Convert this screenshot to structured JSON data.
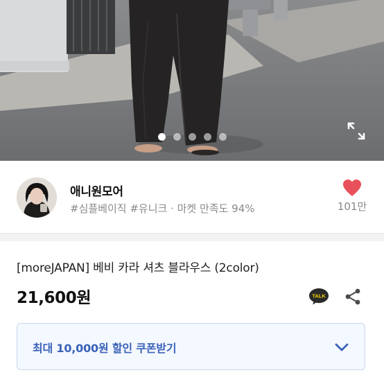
{
  "gallery": {
    "slides": [
      {
        "active": true
      },
      {
        "active": false
      },
      {
        "active": false
      },
      {
        "active": false
      },
      {
        "active": false
      }
    ],
    "expand_icon": "expand-icon"
  },
  "seller": {
    "name": "애니원모어",
    "tags": "#심플베이직 #유니크 · 마켓 만족도 94%",
    "likes": "101만",
    "like_icon": "heart-icon",
    "like_color": "#e8505b"
  },
  "product": {
    "title": "[moreJAPAN] 베비 카라 셔츠 블라우스 (2color)",
    "price": "21,600원",
    "talk_badge": "TALK",
    "share_icon": "share-icon"
  },
  "coupon": {
    "label": "최대 10,000원 할인 쿠폰받기",
    "accent": "#3a62b8",
    "chevron_icon": "chevron-down-icon"
  }
}
